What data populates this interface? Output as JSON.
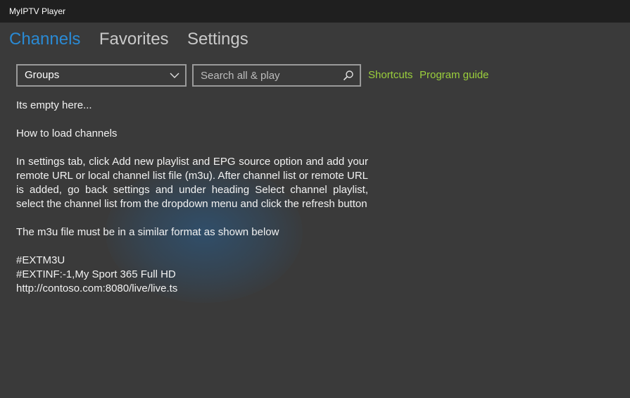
{
  "window": {
    "title": "MyIPTV Player"
  },
  "nav": {
    "tabs": [
      {
        "label": "Channels",
        "active": true
      },
      {
        "label": "Favorites",
        "active": false
      },
      {
        "label": "Settings",
        "active": false
      }
    ]
  },
  "toolbar": {
    "groups_value": "Groups",
    "search_placeholder": "Search all & play",
    "shortcuts_label": "Shortcuts",
    "program_guide_label": "Program guide"
  },
  "content": {
    "empty_text": "Its empty here...",
    "howto_heading": "How to load  channels",
    "instructions": "In settings tab, click Add new playlist and EPG source  option and add your remote URL or local channel list file (m3u). After channel list or remote URL is added, go back settings and under heading  Select channel playlist, select the channel list from the dropdown menu and click the refresh button",
    "format_note": "The m3u file must be in a similar format as shown below",
    "example_lines": [
      "#EXTM3U",
      "#EXTINF:-1,My Sport 365 Full HD",
      "http://contoso.com:8080/live/live.ts"
    ]
  },
  "icons": {
    "dropdown": "chevron-down-icon",
    "search": "search-icon"
  },
  "colors": {
    "accent_active_tab": "#2a8ad4",
    "link": "#9bcf3c",
    "background": "#3a3a3a",
    "titlebar": "#1f1f1f"
  }
}
